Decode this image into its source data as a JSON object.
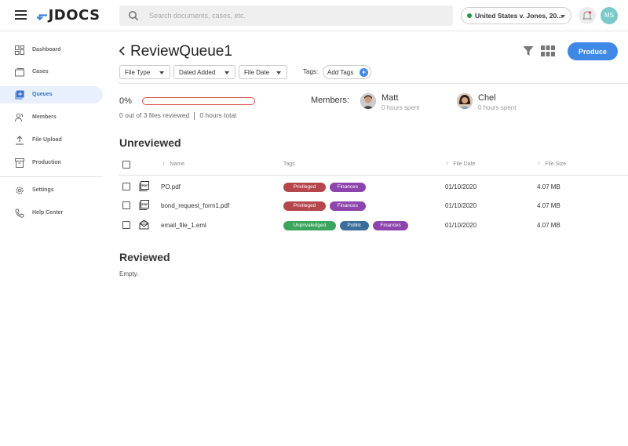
{
  "topbar": {
    "logo": "JDOCS",
    "search_placeholder": "Search documents, cases, etc.",
    "case_selector": "United States v. Jones, 20...",
    "user_initials": "MS"
  },
  "sidebar": {
    "items": [
      {
        "label": "Dashboard",
        "icon": "dashboard-icon"
      },
      {
        "label": "Cases",
        "icon": "cases-icon"
      },
      {
        "label": "Queues",
        "icon": "queues-icon",
        "active": true
      },
      {
        "label": "Members",
        "icon": "members-icon"
      },
      {
        "label": "File Upload",
        "icon": "upload-icon"
      },
      {
        "label": "Production",
        "icon": "production-icon"
      },
      {
        "label": "Settings",
        "icon": "gear-icon"
      },
      {
        "label": "Help Center",
        "icon": "phone-icon"
      }
    ]
  },
  "page": {
    "title": "ReviewQueue1",
    "produce_label": "Produce",
    "filters": [
      "File Type",
      "Dated Added",
      "File Date"
    ],
    "tags_label": "Tags:",
    "add_tags_label": "Add Tags"
  },
  "progress": {
    "percent_label": "0%",
    "fraction": 0,
    "files_reviewed": "0 out of 3 files reviewed",
    "hours_total": "0 hours total"
  },
  "members": {
    "label": "Members:",
    "list": [
      {
        "name": "Matt",
        "hours": "0 hours spent"
      },
      {
        "name": "Chel",
        "hours": "0 hours spent"
      }
    ]
  },
  "unreviewed": {
    "heading": "Unreviewed",
    "columns": [
      "Name",
      "Tags",
      "File Date",
      "File Size"
    ],
    "rows": [
      {
        "name": "PO.pdf",
        "icon": "pdf-icon",
        "tags": [
          {
            "label": "Privileged",
            "color": "#b5474c"
          },
          {
            "label": "Finances",
            "color": "#8e44ad"
          }
        ],
        "date": "01/10/2020",
        "size": "4.07 MB"
      },
      {
        "name": "bond_request_form1.pdf",
        "icon": "pdf-icon",
        "tags": [
          {
            "label": "Privileged",
            "color": "#b5474c"
          },
          {
            "label": "Finances",
            "color": "#8e44ad"
          }
        ],
        "date": "01/10/2020",
        "size": "4.07 MB"
      },
      {
        "name": "email_file_1.eml",
        "icon": "email-icon",
        "tags": [
          {
            "label": "Unprivaledged",
            "color": "#3aa55d"
          },
          {
            "label": "Public",
            "color": "#3b6e9a"
          },
          {
            "label": "Finances",
            "color": "#8e44ad"
          }
        ],
        "date": "01/10/2020",
        "size": "4.07 MB"
      }
    ]
  },
  "reviewed": {
    "heading": "Reviewed",
    "empty_text": "Empty."
  }
}
